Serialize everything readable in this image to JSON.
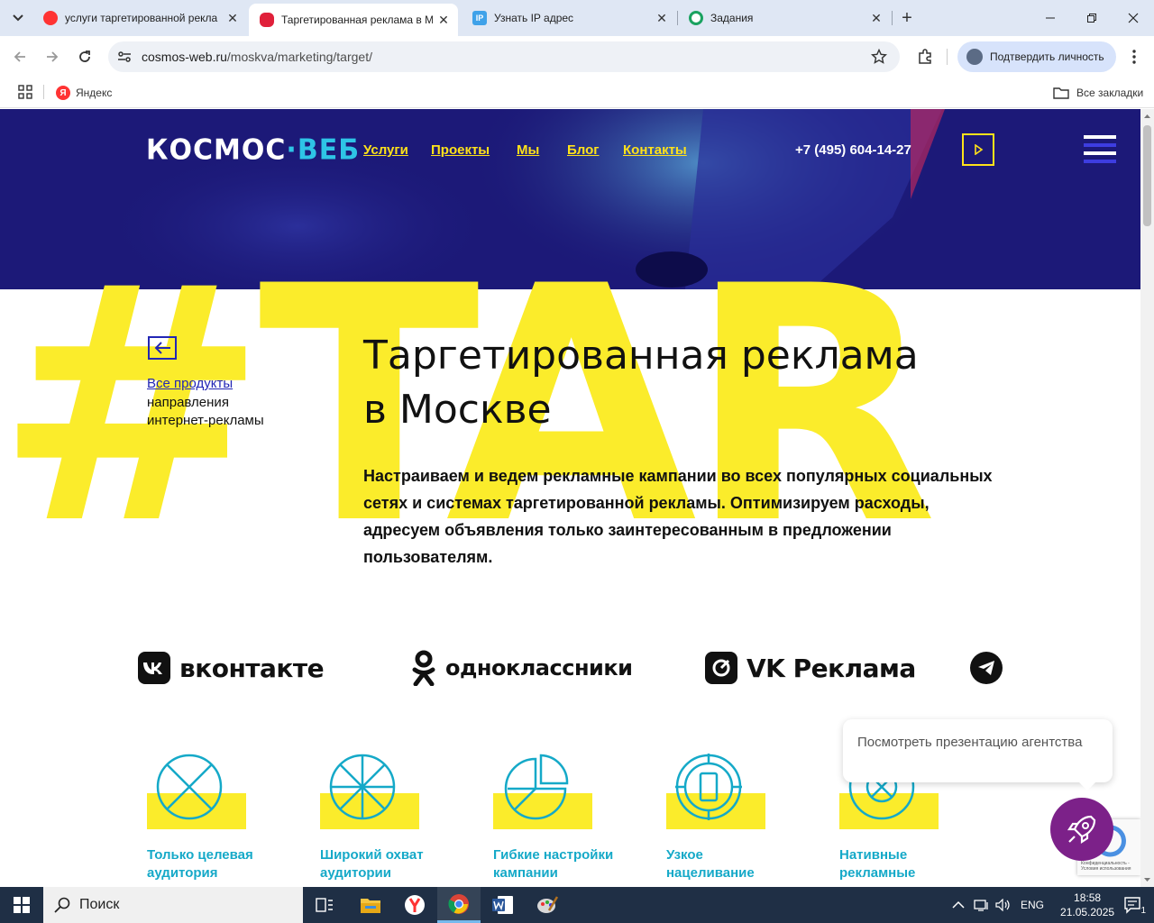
{
  "browser": {
    "tabs": [
      {
        "title": "услуги таргетированной рекла",
        "favicon": "yandex-icon",
        "color": "#f33"
      },
      {
        "title": "Таргетированная реклама в М",
        "favicon": "cosmos-web-icon",
        "color": "#e0203a",
        "active": true
      },
      {
        "title": "Узнать IP адрес",
        "favicon": "ip-icon",
        "color": "#3fa2e9"
      },
      {
        "title": "Задания",
        "favicon": "tasks-icon",
        "color": "#1aa260"
      }
    ],
    "address": {
      "domain": "cosmos-web.ru",
      "path": "/moskva/marketing/target/"
    },
    "verify_label": "Подтвердить личность",
    "bookmarks": {
      "yandex": "Яндекс",
      "all": "Все закладки"
    }
  },
  "site": {
    "logo_main": "КОСМОС",
    "logo_dot": "·",
    "logo_accent": "ВЕБ",
    "nav": [
      "Услуги",
      "Проекты",
      "Мы",
      "Блог",
      "Контакты"
    ],
    "phone": "+7 (495) 604-14-27",
    "big_text": "#TAR",
    "back_link": "Все продукты",
    "back_desc_1": "направления",
    "back_desc_2": "интернет-рекламы",
    "title_line1": "Таргетированная реклама",
    "title_line2": "в Москве",
    "lead": "Настраиваем и ведем рекламные кампании во всех популярных социальных сетях и системах таргетированной рекламы. Оптимизируем расходы, адресуем объявления только заинтересованным в предложении пользователям.",
    "brands": [
      {
        "name": "вконтакте",
        "icon": "vk-icon"
      },
      {
        "name": "одноклассники",
        "icon": "ok-icon"
      },
      {
        "name": "VK Реклама",
        "icon": "vk-ads-icon"
      },
      {
        "name": "",
        "icon": "telegram-icon"
      }
    ],
    "features": [
      {
        "line1": "Только целевая",
        "line2": "аудитория"
      },
      {
        "line1": "Широкий охват",
        "line2": "аудитории"
      },
      {
        "line1": "Гибкие настройки",
        "line2": "кампании"
      },
      {
        "line1": "Узкое",
        "line2": "нацеливание"
      },
      {
        "line1": "Нативные",
        "line2": "рекламные"
      }
    ],
    "bubble": "Посмотреть презентацию агентства",
    "recaptcha": "Конфиденциальность - Условия использования"
  },
  "taskbar": {
    "search": "Поиск",
    "lang": "ENG",
    "time": "18:58",
    "date": "21.05.2025",
    "notif_count": "1"
  },
  "colors": {
    "hero_bg": "#1c1978",
    "yellow": "#fbec2b",
    "accent_teal": "#15a9c8",
    "link_blue": "#2226b5",
    "rocket": "#7c2189"
  }
}
